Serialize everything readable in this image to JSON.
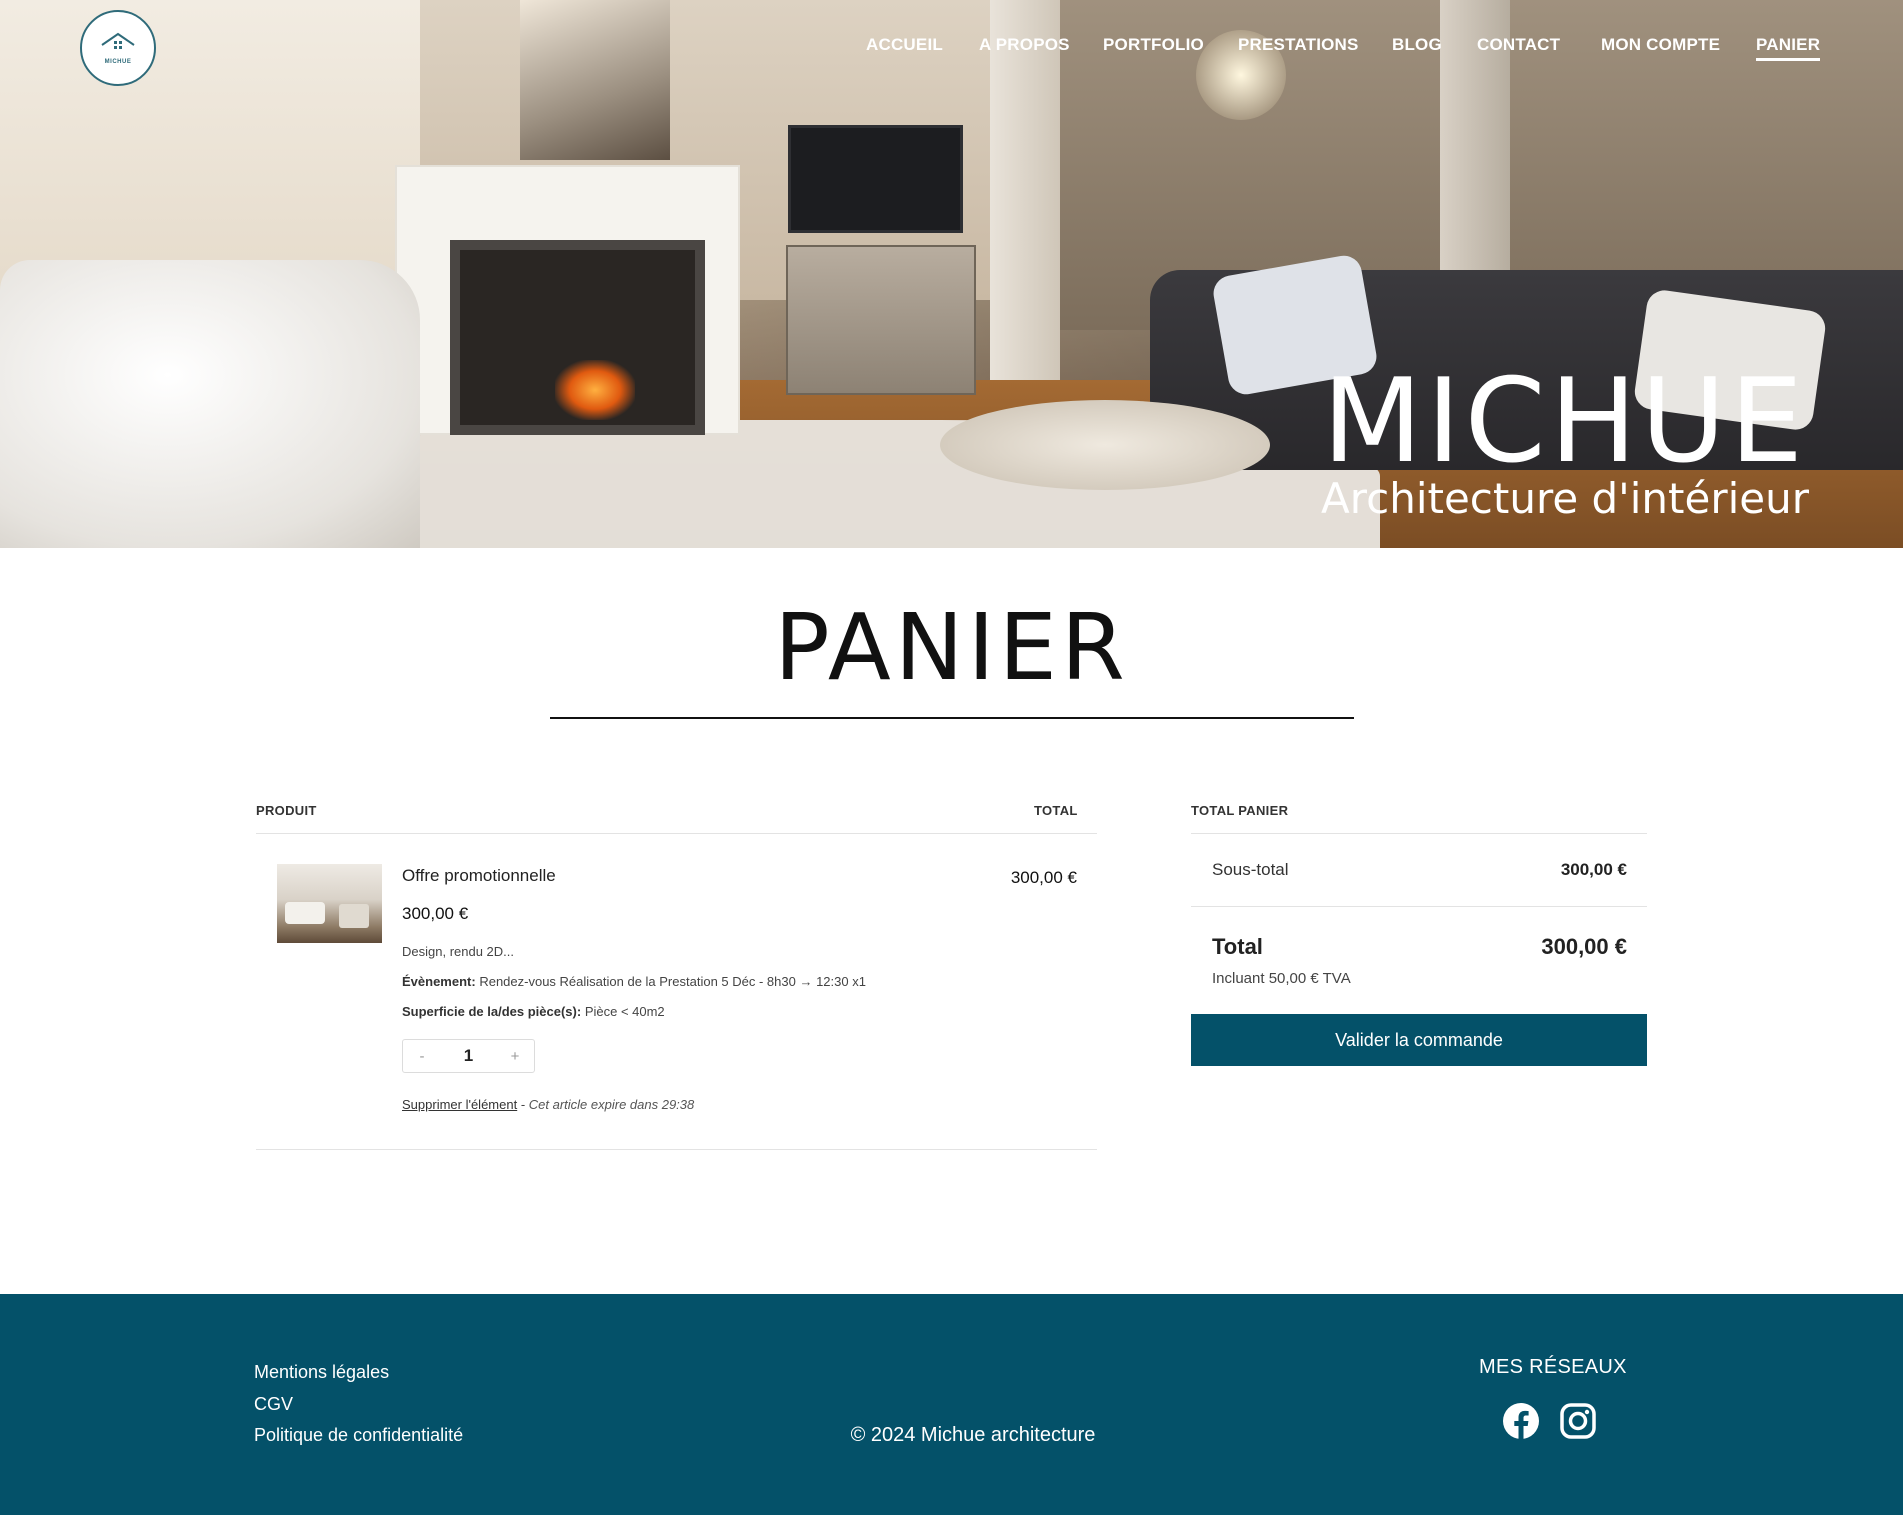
{
  "site": {
    "logo_text": "MICHUE",
    "brand_title": "MICHUE",
    "brand_subtitle": "Architecture d'intérieur"
  },
  "nav": {
    "items": [
      {
        "label": "ACCUEIL"
      },
      {
        "label": "A PROPOS"
      },
      {
        "label": "PORTFOLIO"
      },
      {
        "label": "PRESTATIONS"
      },
      {
        "label": "BLOG"
      },
      {
        "label": "CONTACT"
      },
      {
        "label": "MON COMPTE"
      },
      {
        "label": "PANIER",
        "active": true
      }
    ]
  },
  "cart": {
    "heading": "PANIER",
    "col_product": "PRODUIT",
    "col_total": "TOTAL",
    "item": {
      "name": "Offre promotionnelle",
      "price": "300,00 €",
      "description": "Design, rendu 2D...",
      "event_label": "Évènement:",
      "event_value": "Rendez-vous Réalisation de la Prestation 5 Déc - 8h30 → 12:30 x1",
      "surface_label": "Superficie de la/des pièce(s):",
      "surface_value": "Pièce < 40m2",
      "qty_minus": "-",
      "qty": "1",
      "qty_plus": "+",
      "remove_label": "Supprimer l'élément",
      "separator": " - ",
      "expire_text": "Cet article expire dans 29:38",
      "line_total": "300,00 €"
    }
  },
  "totals": {
    "heading": "TOTAL PANIER",
    "subtotal_label": "Sous-total",
    "subtotal_value": "300,00 €",
    "total_label": "Total",
    "total_value": "300,00 €",
    "tax_note": "Incluant 50,00 € TVA",
    "checkout_label": "Valider la commande"
  },
  "footer": {
    "links": [
      "Mentions légales",
      "CGV",
      "Politique de confidentialité"
    ],
    "copyright": "© 2024 Michue architecture",
    "social_title": "MES RÉSEAUX",
    "social_icons": [
      "facebook-icon",
      "instagram-icon"
    ]
  },
  "colors": {
    "primary": "#045169",
    "text": "#222222",
    "white": "#ffffff"
  }
}
